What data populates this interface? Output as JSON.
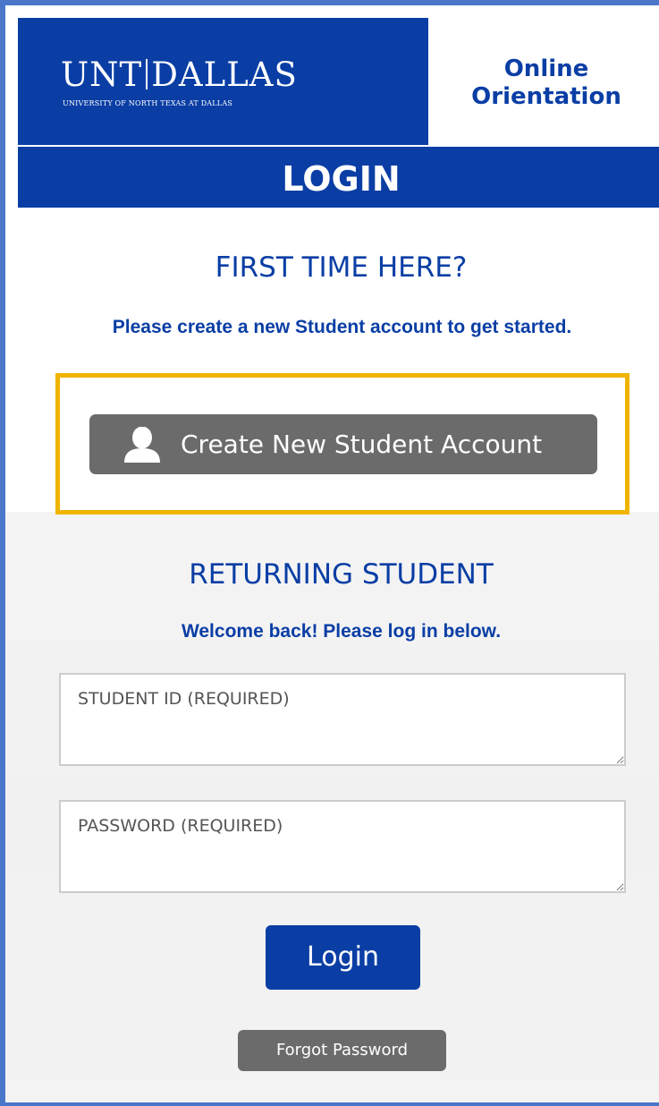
{
  "header": {
    "logo_main_left": "UNT",
    "logo_main_right": "DALLAS",
    "logo_sub": "UNIVERSITY OF NORTH TEXAS AT DALLAS",
    "orientation_line1": "Online",
    "orientation_line2": "Orientation"
  },
  "login_bar": {
    "title": "LOGIN"
  },
  "first_time": {
    "heading": "FIRST TIME HERE?",
    "message": "Please create a new Student account to get started.",
    "create_button_label": "Create New Student Account",
    "create_button_icon": "person-icon"
  },
  "returning": {
    "heading": "RETURNING STUDENT",
    "message": "Welcome back! Please log in below.",
    "student_id_placeholder": "STUDENT ID (REQUIRED)",
    "student_id_value": "",
    "password_placeholder": "PASSWORD (REQUIRED)",
    "password_value": "",
    "login_button_label": "Login",
    "forgot_button_label": "Forgot Password"
  },
  "colors": {
    "brand_blue": "#0a3ea5",
    "frame_blue": "#4a77c9",
    "button_gray": "#6b6b6b",
    "highlight_gold": "#f0b400"
  }
}
